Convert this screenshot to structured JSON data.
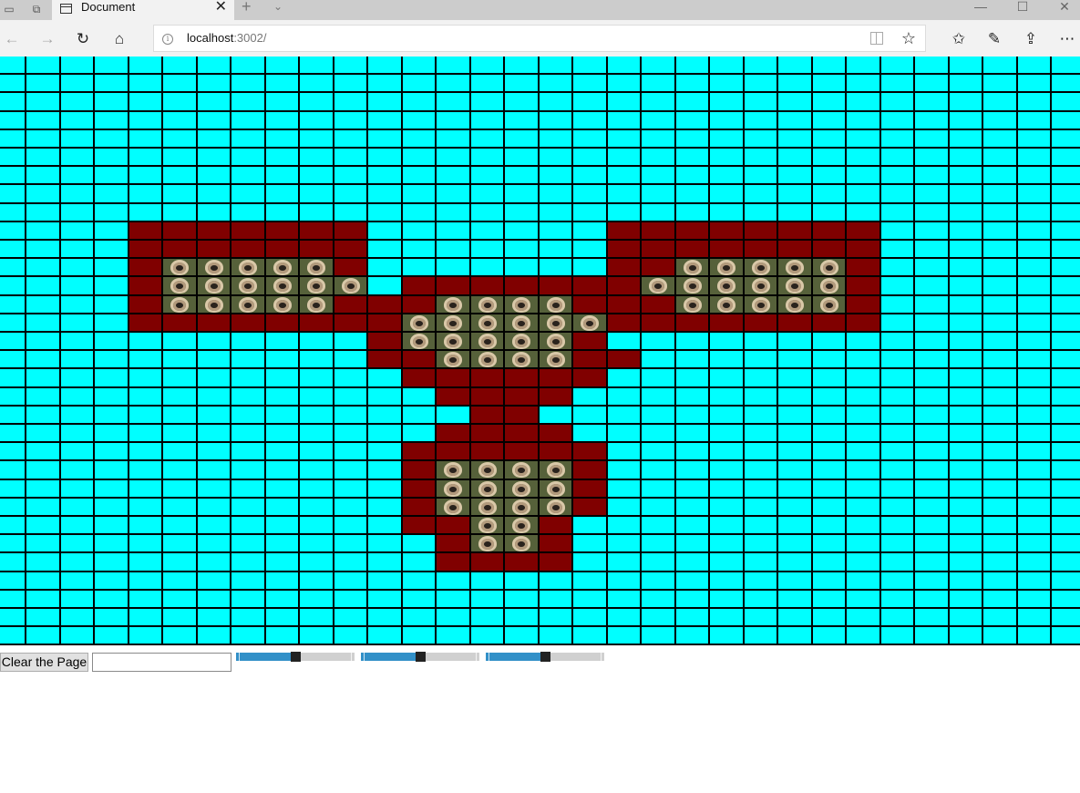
{
  "browser": {
    "tab_title": "Document",
    "tab_close_glyph": "✕",
    "new_tab_glyph": "+",
    "tab_menu_glyph": "⌄",
    "window_buttons": {
      "minimize": "—",
      "maximize": "☐",
      "close": "✕"
    },
    "nav": {
      "back": "←",
      "forward": "→",
      "refresh": "↻",
      "home": "⌂"
    },
    "address": {
      "host": "localhost",
      "rest": ":3002/"
    },
    "info_glyph": "i",
    "star_glyph": "☆",
    "toolbar_glyphs": {
      "favorites": "✩",
      "notes": "✎",
      "share": "⇪",
      "more": "⋯"
    }
  },
  "colors": {
    "background_cell": "#00ffff",
    "painted_cell": "#800000",
    "grid_line": "#000000",
    "accent_slider": "#3290c8"
  },
  "grid": {
    "columns": 32,
    "rows": 32,
    "cells": {
      "9": {
        "maroon": [
          [
            4,
            10
          ],
          [
            18,
            25
          ]
        ]
      },
      "10": {
        "maroon": [
          [
            4,
            10
          ],
          [
            18,
            25
          ]
        ]
      },
      "11": {
        "maroon": [
          [
            4,
            4
          ],
          [
            10,
            10
          ],
          [
            18,
            19
          ],
          [
            25,
            25
          ]
        ],
        "pug": [
          [
            5,
            9
          ],
          [
            20,
            24
          ]
        ]
      },
      "12": {
        "maroon": [
          [
            4,
            4
          ],
          [
            12,
            18
          ],
          [
            25,
            25
          ]
        ],
        "pug": [
          [
            5,
            10
          ],
          [
            19,
            24
          ]
        ]
      },
      "13": {
        "maroon": [
          [
            4,
            4
          ],
          [
            10,
            12
          ],
          [
            17,
            19
          ],
          [
            25,
            25
          ]
        ],
        "pug": [
          [
            5,
            9
          ],
          [
            13,
            16
          ],
          [
            20,
            24
          ]
        ]
      },
      "14": {
        "maroon": [
          [
            4,
            11
          ],
          [
            18,
            25
          ]
        ],
        "pug": [
          [
            12,
            17
          ]
        ]
      },
      "15": {
        "maroon": [
          [
            11,
            11
          ],
          [
            17,
            17
          ]
        ],
        "pug": [
          [
            12,
            16
          ]
        ]
      },
      "16": {
        "maroon": [
          [
            11,
            12
          ],
          [
            17,
            18
          ]
        ],
        "pug": [
          [
            13,
            16
          ]
        ]
      },
      "17": {
        "maroon": [
          [
            12,
            17
          ]
        ]
      },
      "18": {
        "maroon": [
          [
            13,
            16
          ]
        ]
      },
      "19": {
        "maroon": [
          [
            14,
            15
          ]
        ]
      },
      "20": {
        "maroon": [
          [
            13,
            16
          ]
        ]
      },
      "21": {
        "maroon": [
          [
            12,
            17
          ]
        ]
      },
      "22": {
        "maroon": [
          [
            12,
            12
          ],
          [
            17,
            17
          ]
        ],
        "pug": [
          [
            13,
            16
          ]
        ]
      },
      "23": {
        "maroon": [
          [
            12,
            12
          ],
          [
            17,
            17
          ]
        ],
        "pug": [
          [
            13,
            16
          ]
        ]
      },
      "24": {
        "maroon": [
          [
            12,
            12
          ],
          [
            17,
            17
          ]
        ],
        "pug": [
          [
            13,
            16
          ]
        ]
      },
      "25": {
        "maroon": [
          [
            12,
            13
          ],
          [
            16,
            16
          ]
        ],
        "pug": [
          [
            14,
            15
          ]
        ]
      },
      "26": {
        "maroon": [
          [
            13,
            13
          ],
          [
            16,
            16
          ]
        ],
        "pug": [
          [
            14,
            15
          ]
        ]
      },
      "27": {
        "maroon": [
          [
            13,
            16
          ]
        ]
      }
    }
  },
  "controls": {
    "clear_button_label": "Clear the Page",
    "text_input_value": "",
    "sliders": [
      {
        "name": "slider-1",
        "value_fraction": 0.5
      },
      {
        "name": "slider-2",
        "value_fraction": 0.5
      },
      {
        "name": "slider-3",
        "value_fraction": 0.5
      }
    ]
  }
}
